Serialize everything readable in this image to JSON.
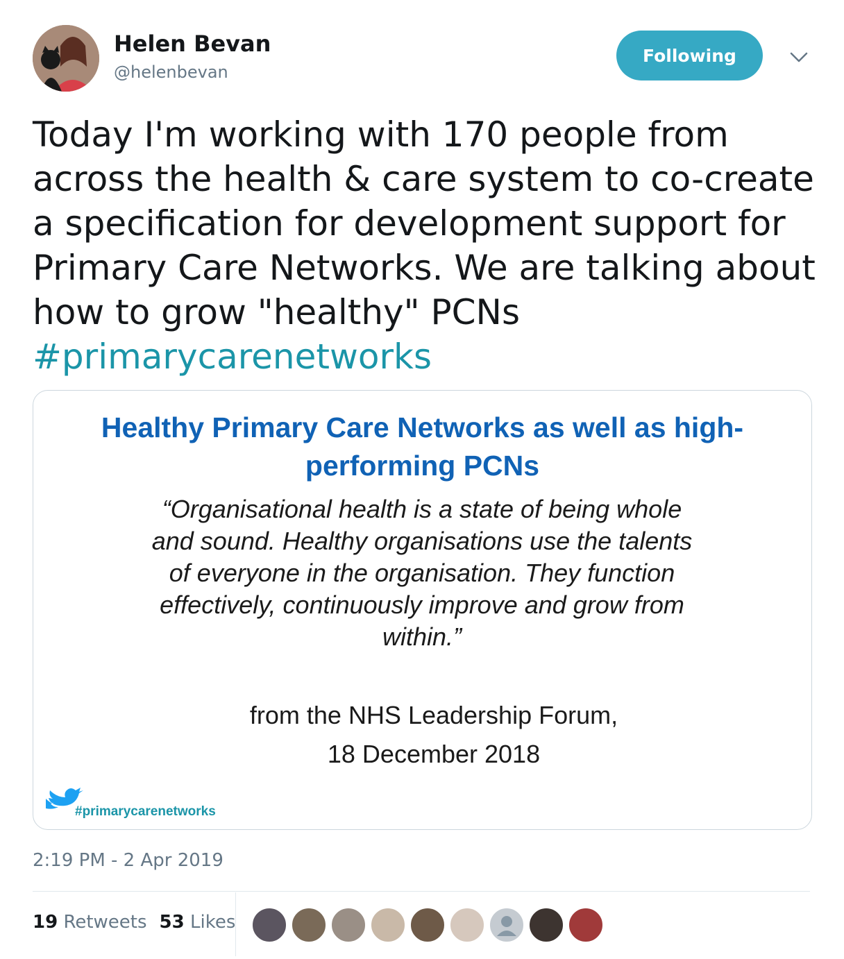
{
  "user": {
    "name": "Helen Bevan",
    "handle": "@helenbevan",
    "follow_label": "Following"
  },
  "tweet": {
    "text": "Today I'm working with 170 people from\nacross the health & care system to co-create\na specification for development support for\nPrimary Care Networks. We are talking about\nhow to grow \"healthy\" PCNs\n",
    "hashtag": "#primarycarenetworks"
  },
  "card": {
    "title": "Healthy Primary Care Networks as well as high-performing PCNs",
    "quote": "“Organisational health is a state of being whole and sound. Healthy organisations use the talents of everyone in the organisation. They function effectively, continuously improve and grow from within.”",
    "source_line1": "from the NHS Leadership Forum,",
    "source_line2": "18 December 2018",
    "tag": "#primarycarenetworks"
  },
  "timestamp": "2:19 PM - 2 Apr 2019",
  "stats": {
    "retweets_count": "19",
    "retweets_label": "Retweets",
    "likes_count": "53",
    "likes_label": "Likes"
  },
  "colors": {
    "accent": "#36a9c4",
    "hashtag": "#1b95a8",
    "card_title": "#1062b5",
    "muted": "#657786"
  },
  "icons": {
    "chevron": "chevron-down-icon",
    "bird": "twitter-bird-icon"
  }
}
